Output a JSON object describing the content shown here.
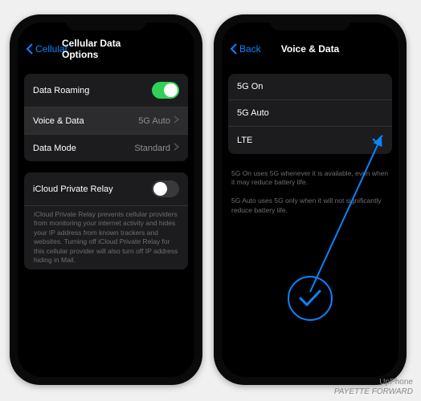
{
  "phoneA": {
    "back": "Cellular",
    "title": "Cellular Data Options",
    "group1": {
      "roaming": {
        "label": "Data Roaming",
        "on": true
      },
      "voice": {
        "label": "Voice & Data",
        "value": "5G Auto"
      },
      "mode": {
        "label": "Data Mode",
        "value": "Standard"
      }
    },
    "group2": {
      "relay": {
        "label": "iCloud Private Relay",
        "on": false
      },
      "disclaimer": "iCloud Private Relay prevents cellular providers from monitoring your internet activity and hides your IP address from known trackers and websites. Turning off iCloud Private Relay for this cellular provider will also turn off IP address hiding in Mail."
    }
  },
  "phoneB": {
    "back": "Back",
    "title": "Voice & Data",
    "options": {
      "opt0": "5G On",
      "opt1": "5G Auto",
      "opt2": "LTE"
    },
    "selected": "LTE",
    "note": "5G On uses 5G whenever it is available, even when it may reduce battery life.\n\n5G Auto uses 5G only when it will not significantly reduce battery life."
  },
  "credits": {
    "line1": "UpPhone",
    "line2": "PAYETTE FORWARD"
  }
}
